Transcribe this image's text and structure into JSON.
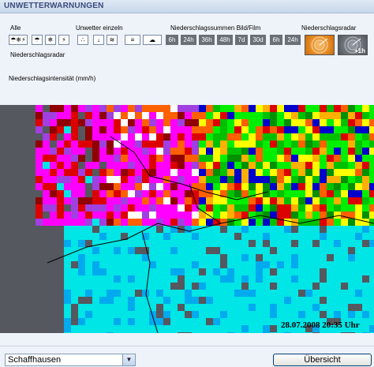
{
  "header": {
    "title": "UNWETTERWARNUNGEN"
  },
  "toolbar": {
    "alle_label": "Alle",
    "einzeln_label": "Unwetter einzeln",
    "summen_label": "Niederschlagssummen Bild/Film",
    "radar_label_right": "Niederschlagsradar",
    "radar_label_left": "Niederschlagsradar",
    "icons": [
      "rain-icon",
      "snow-icon",
      "storm-icon",
      "hail-icon",
      "frost-icon",
      "wind-icon",
      "fog-icon"
    ],
    "bild_buttons": [
      "6h",
      "24h",
      "36h",
      "48h",
      "7d",
      "30d"
    ],
    "film_buttons": [
      "6h",
      "24h"
    ],
    "radar_plus_label": "+1h"
  },
  "legend": {
    "title": "Niederschlagsintensität (mm/h)",
    "colors": [
      "#00e5e5",
      "#00aaee",
      "#0000cc",
      "#0060d0",
      "#00ee00",
      "#00c000",
      "#009000",
      "#ffff00",
      "#ffb000",
      "#ff6000",
      "#dd0000",
      "#900000",
      "#ff00ff",
      "#a040e0",
      "#ffffff"
    ]
  },
  "map": {
    "timestamp": "28.07.2008 20:35 Uhr"
  },
  "footer": {
    "region_select": "Schaffhausen",
    "overview_button": "Übersicht"
  }
}
